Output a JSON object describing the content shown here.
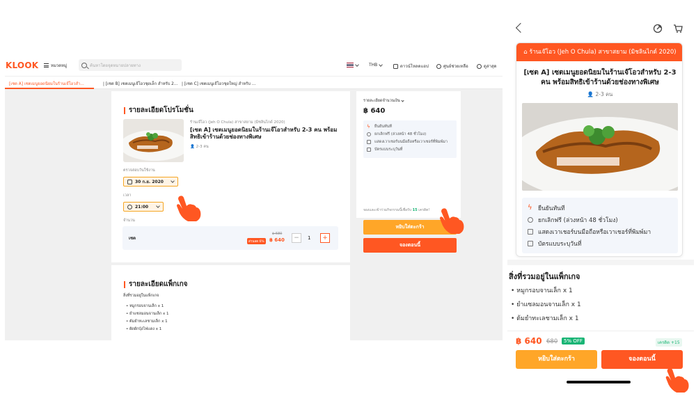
{
  "colors": {
    "brand": "#ff5722",
    "cart_button": "#ffa628",
    "discount_badge": "#19b575"
  },
  "desktop": {
    "logo": "KLOOK",
    "menu_label": "หมวดหมู่",
    "search_placeholder": "ค้นหาโดยจุดหมายปลายทาง",
    "currency": "THB",
    "nav": {
      "download": "ดาวน์โหลดแอป",
      "help": "ศูนย์ช่วยเหลือ",
      "recent": "ดูล่าสุด"
    },
    "tabs": [
      "[เซต A] เซตเมนูยอดนิยมในร้านเจ๊โอวสำ...",
      "| [เซต B] เซตเมนูเจ๊โอวชุดเล็ก สำหรับ 2...",
      "| [เซต C] เซตเมนูเจ๊โอวชุดใหญ่ สำหรับ ..."
    ],
    "promo": {
      "section_title": "รายละเอียดโปรโมชั่น",
      "shop": "ร้านเจ๊โอว (Jeh O Chula) สาขาสยาม (มิชลินไกด์ 2020)",
      "product_name": "[เซต A] เซตเมนูยอดนิยมในร้านเจ๊โอวสำหรับ 2-3 คน พร้อมสิทธิเข้าร้านด้วยช่องทางพิเศษ",
      "pax": "2-3 คน",
      "date_label": "ตรวจสอบวันใช้งาน",
      "date_value": "30 ก.ย. 2020",
      "time_label": "เวลา",
      "time_value": "21:00",
      "qty_label": "จำนวน",
      "item": "เซต",
      "old_price": "฿ 680",
      "discount": "ส่วนลด 6%",
      "price": "฿ 640",
      "minus": "−",
      "quantity": "1",
      "plus": "+"
    },
    "package": {
      "section_title": "รายละเอียดแพ็กเกจ",
      "subtitle": "สิ่งที่รวมอยู่ในแพ็กเกจ",
      "items": [
        "หมูกรอบจานเล็ก x 1",
        "ยำแซลมอนจานเล็ก x 1",
        "ต้มยำทะเลชามเล็ก x 1",
        "ผัดผักบุ้งไฟแดง x 1"
      ]
    },
    "summary": {
      "label": "รายละเอียดจำนวนเงิน",
      "price": "฿ 640",
      "features": [
        "ยืนยันทันที",
        "ยกเลิกฟรี (ล่วงหน้า 48 ชั่วโมง)",
        "แสดงเวาเชอร์บนมือถือหรือเวาเชอร์ที่พิมพ์มา",
        "บัตรแบบระบุวันที่"
      ],
      "add_to_cart": "หยิบใส่ตะกร้า",
      "book_now": "จองตอนนี้",
      "credits_note_prefix": "จองและเข้าร่วมกิจกรรมนี้เพื่อรับ",
      "credits_value": "15",
      "credits_note_suffix": "เครดิต!"
    }
  },
  "mobile": {
    "header": "ร้านเจ๊โอว (Jeh O Chula) สาขาสยาม (มิชลินไกด์ 2020)",
    "title": "[เซต A] เซตเมนูยอดนิยมในร้านเจ๊โอวสำหรับ 2-3 คน พร้อมสิทธิเข้าร้านด้วยช่องทางพิเศษ",
    "pax": "2-3 คน",
    "features": [
      "ยืนยันทันที",
      "ยกเลิกฟรี (ล่วงหน้า 48 ชั่วโมง)",
      "แสดงเวาเชอร์บนมือถือหรือเวาเชอร์ที่พิมพ์มา",
      "บัตรแบบระบุวันที่"
    ],
    "package_title": "สิ่งที่รวมอยู่ในแพ็กเกจ",
    "package_items": [
      "หมูกรอบจานเล็ก x 1",
      "ยำแซลมอนจานเล็ก x 1",
      "ต้มยำทะเลชามเล็ก x 1"
    ],
    "price": "฿ 640",
    "old_price": "680",
    "discount": "5% OFF",
    "credits": "เครดิต +15",
    "add_to_cart": "หยิบใส่ตะกร้า",
    "book_now": "จองตอนนี้"
  }
}
